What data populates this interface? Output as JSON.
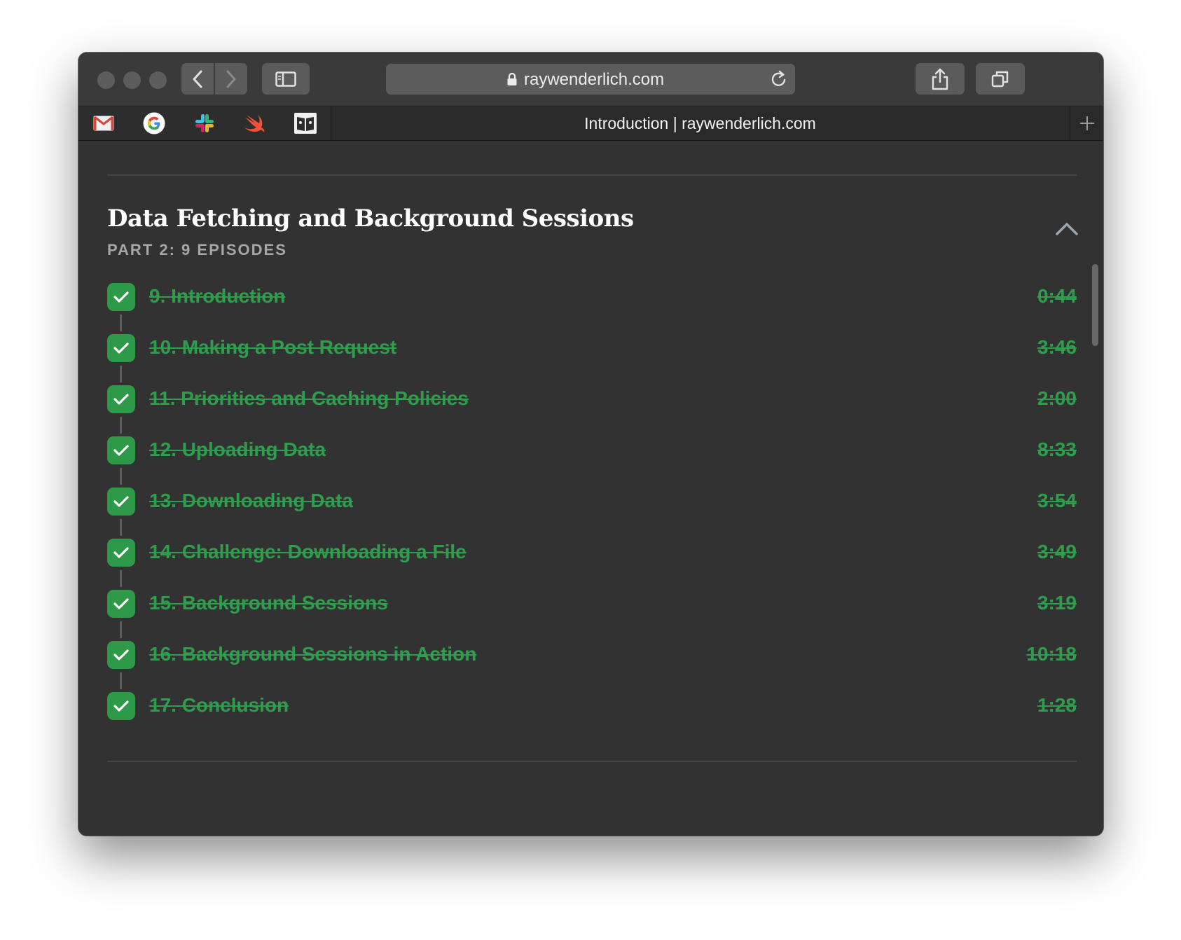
{
  "browser": {
    "url": "raywenderlich.com",
    "tab_title": "Introduction | raywenderlich.com",
    "favorites": [
      {
        "name": "Gmail",
        "icon": "gmail-icon"
      },
      {
        "name": "Google",
        "icon": "google-icon"
      },
      {
        "name": "Slack",
        "icon": "slack-icon"
      },
      {
        "name": "Swift",
        "icon": "swift-icon"
      },
      {
        "name": "Reader",
        "icon": "book-icon"
      }
    ]
  },
  "section": {
    "title": "Data Fetching and Background Sessions",
    "subtitle": "PART 2: 9 EPISODES"
  },
  "episodes": [
    {
      "title": "9. Introduction",
      "duration": "0:44",
      "completed": true
    },
    {
      "title": "10. Making a Post Request",
      "duration": "3:46",
      "completed": true
    },
    {
      "title": "11. Priorities and Caching Policies",
      "duration": "2:00",
      "completed": true
    },
    {
      "title": "12. Uploading Data",
      "duration": "8:33",
      "completed": true
    },
    {
      "title": "13. Downloading Data",
      "duration": "3:54",
      "completed": true
    },
    {
      "title": "14. Challenge: Downloading a File",
      "duration": "3:49",
      "completed": true
    },
    {
      "title": "15. Background Sessions",
      "duration": "3:19",
      "completed": true
    },
    {
      "title": "16. Background Sessions in Action",
      "duration": "10:18",
      "completed": true
    },
    {
      "title": "17. Conclusion",
      "duration": "1:28",
      "completed": true
    }
  ],
  "colors": {
    "accent_green": "#2f9d4e",
    "background": "#323232"
  }
}
